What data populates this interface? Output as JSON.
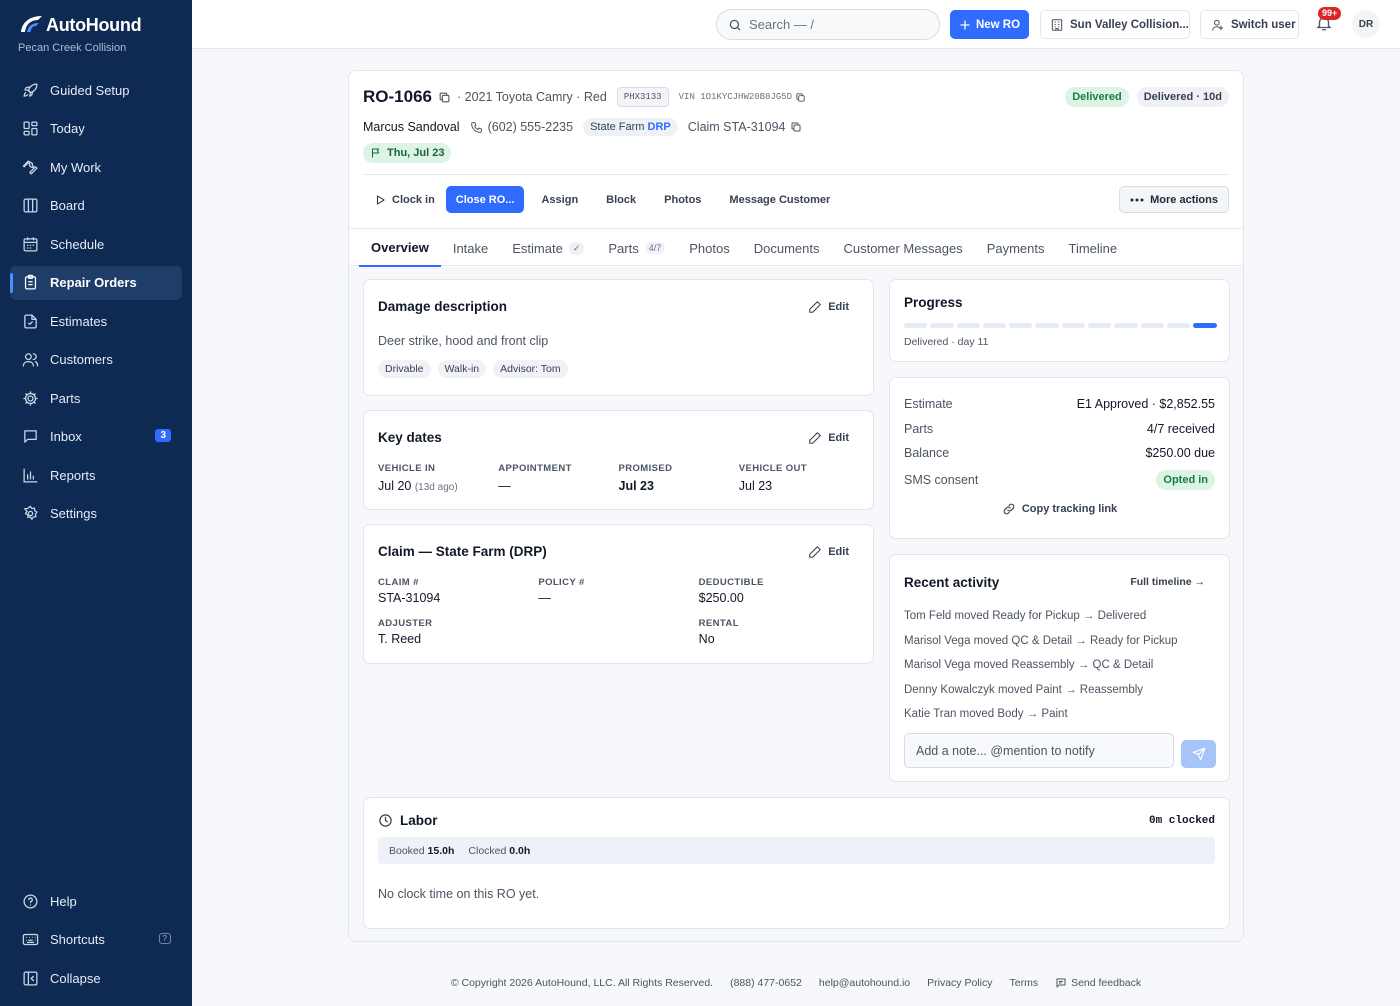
{
  "brand": {
    "name": "AutoHound",
    "shop": "Pecan Creek Collision"
  },
  "nav": [
    {
      "label": "Guided Setup",
      "icon": "rocket-icon"
    },
    {
      "label": "Today",
      "icon": "grid-icon"
    },
    {
      "label": "My Work",
      "icon": "wrench-icon"
    },
    {
      "label": "Board",
      "icon": "columns-icon"
    },
    {
      "label": "Schedule",
      "icon": "calendar-icon"
    },
    {
      "label": "Repair Orders",
      "icon": "clipboard-icon",
      "active": true
    },
    {
      "label": "Estimates",
      "icon": "file-icon"
    },
    {
      "label": "Customers",
      "icon": "users-icon"
    },
    {
      "label": "Parts",
      "icon": "gear-icon"
    },
    {
      "label": "Inbox",
      "icon": "message-icon",
      "badge": "3"
    },
    {
      "label": "Reports",
      "icon": "chart-icon"
    },
    {
      "label": "Settings",
      "icon": "settings-icon"
    }
  ],
  "nav_bottom": [
    {
      "label": "Help",
      "icon": "help-icon"
    },
    {
      "label": "Shortcuts",
      "icon": "keyboard-icon",
      "key": "?"
    },
    {
      "label": "Collapse",
      "icon": "collapse-icon"
    }
  ],
  "topbar": {
    "search_placeholder": "Search — /",
    "new_ro": "New RO",
    "shop_selector": "Sun Valley Collision...",
    "switch_user": "Switch user",
    "notif_badge": "99+",
    "avatar": "DR"
  },
  "ro": {
    "number": "RO-1066",
    "vehicle": "· 2021 Toyota Camry · Red",
    "plate": "PHX3133",
    "vin": "VIN 1O1KYCJHW20B8JG5D",
    "status": "Delivered",
    "status_age": "Delivered · 10d",
    "customer": "Marcus Sandoval",
    "phone": "(602) 555-2235",
    "insurer": "State Farm",
    "insurer_tag": "DRP",
    "claim": "Claim STA-31094",
    "promised": "Thu, Jul 23"
  },
  "actions": {
    "clock_in": "Clock in",
    "close": "Close RO...",
    "assign": "Assign",
    "block": "Block",
    "photos": "Photos",
    "message": "Message Customer",
    "more": "More actions"
  },
  "tabs": [
    {
      "label": "Overview",
      "active": true
    },
    {
      "label": "Intake"
    },
    {
      "label": "Estimate",
      "sub": "✓"
    },
    {
      "label": "Parts",
      "sub": "4/7"
    },
    {
      "label": "Photos"
    },
    {
      "label": "Documents"
    },
    {
      "label": "Customer Messages"
    },
    {
      "label": "Payments"
    },
    {
      "label": "Timeline"
    }
  ],
  "damage": {
    "title": "Damage description",
    "edit": "Edit",
    "text": "Deer strike, hood and front clip",
    "chips": [
      "Drivable",
      "Walk-in",
      "Advisor: Tom"
    ]
  },
  "key_dates": {
    "title": "Key dates",
    "edit": "Edit",
    "items": [
      {
        "label": "VEHICLE IN",
        "value": "Jul 20",
        "note": "(13d ago)"
      },
      {
        "label": "APPOINTMENT",
        "value": "—"
      },
      {
        "label": "PROMISED",
        "value": "Jul 23",
        "bold": true
      },
      {
        "label": "VEHICLE OUT",
        "value": "Jul 23"
      }
    ]
  },
  "claim": {
    "title": "Claim — State Farm (DRP)",
    "edit": "Edit",
    "claim_label": "CLAIM #",
    "claim_value": "STA-31094",
    "policy_label": "POLICY #",
    "policy_value": "—",
    "deductible_label": "DEDUCTIBLE",
    "deductible_value": "$250.00",
    "adjuster_label": "ADJUSTER",
    "adjuster_value": "T. Reed",
    "rental_label": "RENTAL",
    "rental_value": "No"
  },
  "progress": {
    "title": "Progress",
    "steps_total": 12,
    "steps_done": 1,
    "subtitle": "Delivered · day 11"
  },
  "summary": {
    "rows": [
      {
        "k": "Estimate",
        "v": "E1 Approved · $2,852.55"
      },
      {
        "k": "Parts",
        "v": "4/7 received"
      },
      {
        "k": "Balance",
        "v": "$250.00 due"
      },
      {
        "k": "SMS consent",
        "v": "Opted in",
        "pill": true
      }
    ],
    "copy_link": "Copy tracking link"
  },
  "activity": {
    "title": "Recent activity",
    "full": "Full timeline →",
    "items": [
      "Tom Feld moved Ready for Pickup → Delivered",
      "Marisol Vega moved QC & Detail → Ready for Pickup",
      "Marisol Vega moved Reassembly → QC & Detail",
      "Denny Kowalczyk moved Paint → Reassembly",
      "Katie Tran moved Body → Paint"
    ],
    "note_placeholder": "Add a note... @mention to notify"
  },
  "labor": {
    "title": "Labor",
    "clocked": "0m clocked",
    "booked_label": "Booked",
    "booked_value": "15.0h",
    "clocked_label": "Clocked",
    "clocked_value": "0.0h",
    "empty": "No clock time on this RO yet."
  },
  "footer": {
    "copyright": "© Copyright 2026 AutoHound, LLC. All Rights Reserved.",
    "phone": "(888) 477-0652",
    "email": "help@autohound.io",
    "privacy": "Privacy Policy",
    "terms": "Terms",
    "feedback": "Send feedback"
  },
  "colors": {
    "sidebar": "#0f2a52",
    "accent": "#2f6bff",
    "success": "#15803d"
  }
}
